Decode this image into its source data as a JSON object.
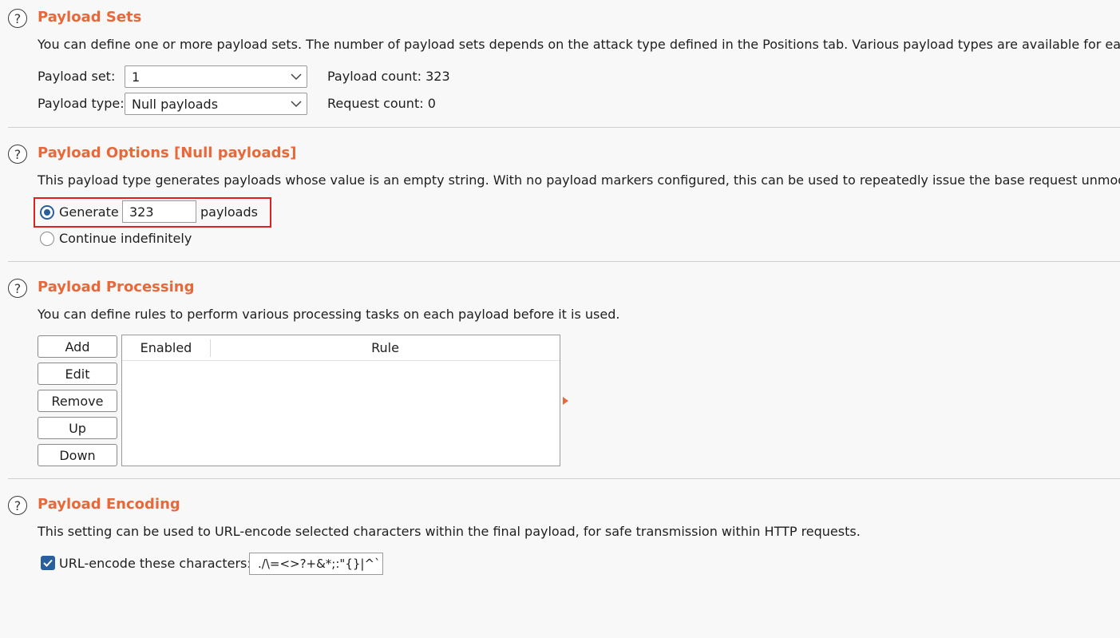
{
  "payload_sets": {
    "title": "Payload Sets",
    "description": "You can define one or more payload sets. The number of payload sets depends on the attack type defined in the Positions tab. Various payload types are available for each payload set, and each payload type can be customized in different ways.",
    "payload_set_label": "Payload set:",
    "payload_set_value": "1",
    "payload_type_label": "Payload type:",
    "payload_type_value": "Null payloads",
    "payload_count": "Payload count: 323",
    "request_count": "Request count: 0"
  },
  "payload_options": {
    "title": "Payload Options [Null payloads]",
    "description": "This payload type generates payloads whose value is an empty string. With no payload markers configured, this can be used to repeatedly issue the base request unmodified.",
    "generate_label": "Generate",
    "generate_value": "323",
    "payloads_label": "payloads",
    "continue_label": "Continue indefinitely"
  },
  "payload_processing": {
    "title": "Payload Processing",
    "description": "You can define rules to perform various processing tasks on each payload before it is used.",
    "buttons": {
      "add": "Add",
      "edit": "Edit",
      "remove": "Remove",
      "up": "Up",
      "down": "Down"
    },
    "columns": {
      "enabled": "Enabled",
      "rule": "Rule"
    }
  },
  "payload_encoding": {
    "title": "Payload Encoding",
    "description": "This setting can be used to URL-encode selected characters within the final payload, for safe transmission within HTTP requests.",
    "checkbox_label": "URL-encode these characters:",
    "characters": "./\\=<>?+&*;:\"{}|^`"
  },
  "icons": {
    "help": "?",
    "chevron": "chevron-down-icon",
    "check": "check-icon"
  },
  "colors": {
    "accent": "#e8683a",
    "selected": "#2a5f9e",
    "highlight": "#e02020"
  }
}
